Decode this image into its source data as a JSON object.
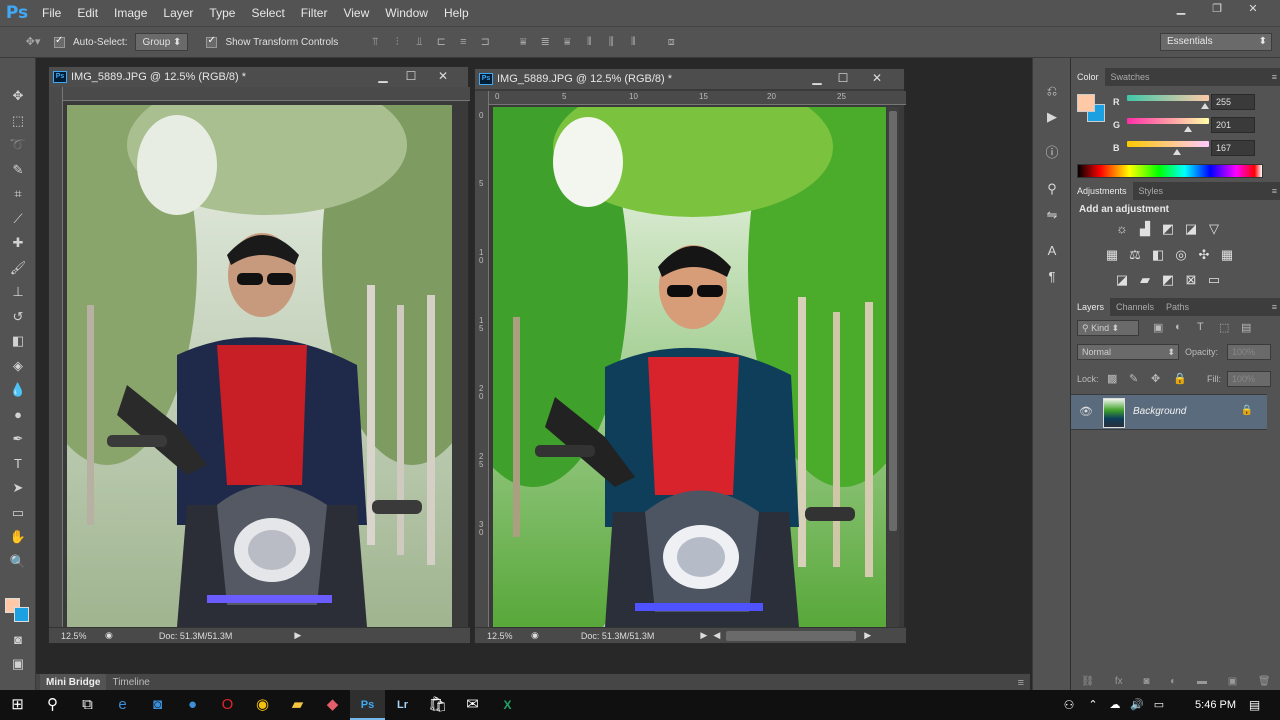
{
  "app": {
    "logo": "Ps",
    "menu": [
      "File",
      "Edit",
      "Image",
      "Layer",
      "Type",
      "Select",
      "Filter",
      "View",
      "Window",
      "Help"
    ]
  },
  "options": {
    "auto_select_label": "Auto-Select:",
    "auto_select_value": "Group",
    "transform_label": "Show Transform Controls",
    "workspace": "Essentials"
  },
  "documents": [
    {
      "title": "IMG_5889.JPG @ 12.5% (RGB/8) *",
      "zoom": "12.5%",
      "doc_info": "Doc: 51.3M/51.3M",
      "ruler_top": [],
      "ruler_left": []
    },
    {
      "title": "IMG_5889.JPG @ 12.5% (RGB/8) *",
      "zoom": "12.5%",
      "doc_info": "Doc: 51.3M/51.3M",
      "ruler_top": [
        "0",
        "5",
        "10",
        "15",
        "20",
        "25"
      ],
      "ruler_left": [
        "0",
        "5",
        "1\n0",
        "1\n5",
        "2\n0",
        "2\n5",
        "3\n0"
      ]
    }
  ],
  "bottom_tabs": [
    "Mini Bridge",
    "Timeline"
  ],
  "color_panel": {
    "tabs": [
      "Color",
      "Swatches"
    ],
    "foreground": "#ffc9a7",
    "background": "#1ba1e2",
    "channels": [
      {
        "label": "R",
        "value": "255",
        "fraction": 1.0
      },
      {
        "label": "G",
        "value": "201",
        "fraction": 0.788
      },
      {
        "label": "B",
        "value": "167",
        "fraction": 0.655
      }
    ]
  },
  "adjustments_panel": {
    "tabs": [
      "Adjustments",
      "Styles"
    ],
    "heading": "Add an adjustment"
  },
  "layers_panel": {
    "tabs": [
      "Layers",
      "Channels",
      "Paths"
    ],
    "kind_label": "Kind",
    "blend_mode": "Normal",
    "opacity_label": "Opacity:",
    "opacity_value": "100%",
    "lock_label": "Lock:",
    "fill_label": "Fill:",
    "fill_value": "100%",
    "layer_name": "Background"
  },
  "taskbar": {
    "time": "5:46 PM"
  }
}
